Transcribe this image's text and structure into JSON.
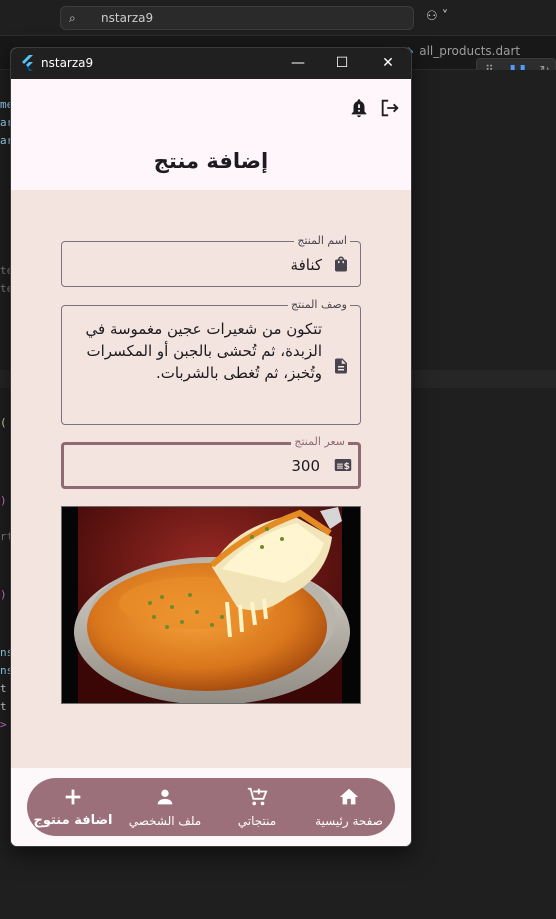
{
  "ide": {
    "search_text": "nstarza9",
    "right_tab": "all_products.dart"
  },
  "window": {
    "title": "nstarza9",
    "minimize": "—",
    "maximize": "☐",
    "close": "✕"
  },
  "page": {
    "title": "إضافة منتج"
  },
  "form": {
    "name": {
      "label": "اسم المنتج",
      "value": "كنافة"
    },
    "description": {
      "label": "وصف المنتج",
      "value": "تتكون من شعيرات عجين مغموسة في الزبدة، ثم تُحشى بالجبن أو المكسرات وتُخبز، ثم تُغطى بالشربات."
    },
    "price": {
      "label": "سعر المنتج",
      "value": "300"
    }
  },
  "bottom_nav": {
    "items": [
      {
        "label": "اضافة منتوج",
        "icon": "plus-icon",
        "active": true
      },
      {
        "label": "ملف الشخصي",
        "icon": "person-icon",
        "active": false
      },
      {
        "label": "منتجاتي",
        "icon": "cart-icon",
        "active": false
      },
      {
        "label": "صفحة رئيسية",
        "icon": "home-icon",
        "active": false
      }
    ]
  },
  "colors": {
    "accent": "#9c707b",
    "focused_border": "#8f6a72",
    "body_bg": "#f4e4df",
    "appbar_bg": "#fff6fc"
  }
}
